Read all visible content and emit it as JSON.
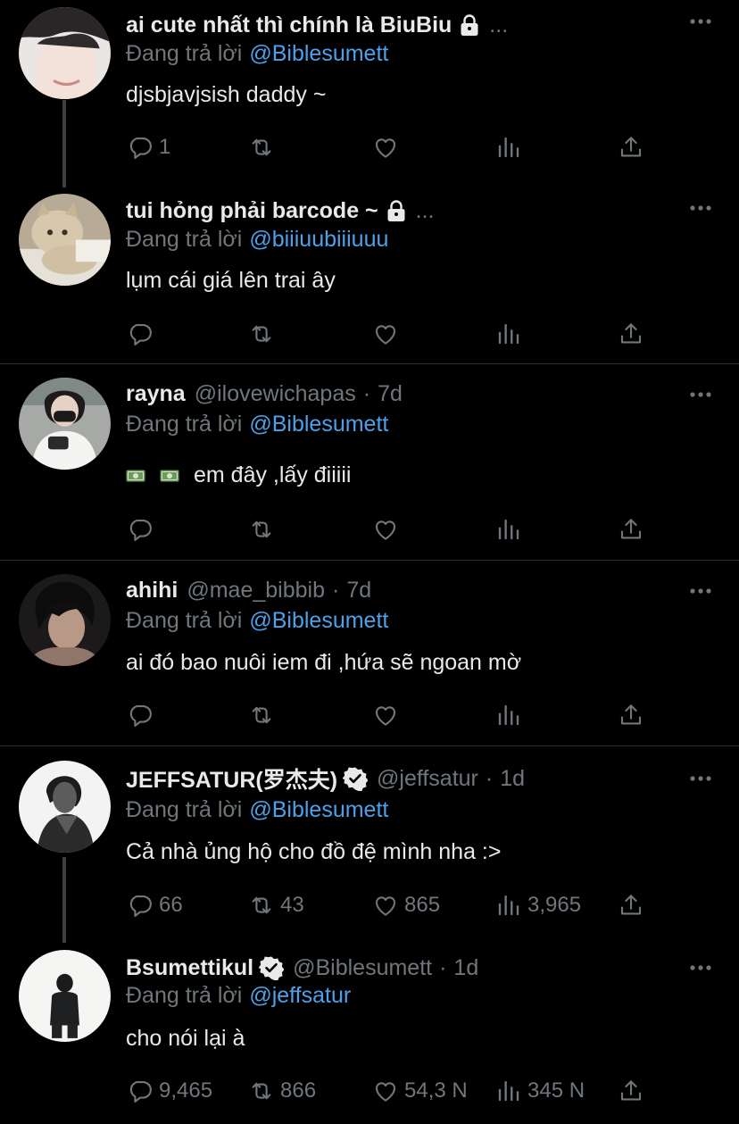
{
  "reply_prefix": "Đang trả lời",
  "tweets": [
    {
      "name": "ai cute nhất thì chính là BiuBiu",
      "handle": "",
      "time": "",
      "locked": true,
      "trailing": "...",
      "reply_to": "@Biblesumett",
      "text": "djsbjavjsish daddy ~",
      "replies": "1",
      "retweets": "",
      "likes": "",
      "views": ""
    },
    {
      "name": "tui hỏng phải barcode ~",
      "handle": "",
      "time": "",
      "locked": true,
      "trailing": "...",
      "reply_to": "@biiiuubiiiuuu",
      "text": "lụm cái giá lên trai ây",
      "replies": "",
      "retweets": "",
      "likes": "",
      "views": ""
    },
    {
      "name": "rayna",
      "handle": "@ilovewichapas",
      "time": "7d",
      "locked": false,
      "trailing": "",
      "reply_to": "@Biblesumett",
      "text": "em đây ,lấy điiiii",
      "replies": "",
      "retweets": "",
      "likes": "",
      "views": ""
    },
    {
      "name": "ahihi",
      "handle": "@mae_bibbib",
      "time": "7d",
      "locked": false,
      "trailing": "",
      "reply_to": "@Biblesumett",
      "text": "ai đó bao nuôi iem đi ,hứa sẽ ngoan mờ",
      "replies": "",
      "retweets": "",
      "likes": "",
      "views": ""
    },
    {
      "name": "JEFFSATUR(罗杰夫)",
      "handle": "@jeffsatur",
      "time": "1d",
      "locked": false,
      "verified": true,
      "trailing": "",
      "reply_to": "@Biblesumett",
      "text": "Cả nhà ủng hộ cho đồ đệ mình nha :>",
      "replies": "66",
      "retweets": "43",
      "likes": "865",
      "views": "3,965"
    },
    {
      "name": "Bsumettikul",
      "handle": "@Biblesumett",
      "time": "1d",
      "locked": false,
      "verified": true,
      "trailing": "",
      "reply_to": "@jeffsatur",
      "text": "cho nói lại à",
      "replies": "9,465",
      "retweets": "866",
      "likes": "54,3 N",
      "views": "345 N"
    }
  ],
  "colors": {
    "background": "#000000",
    "text": "#e7e9ea",
    "muted": "#71767b",
    "mention": "#4ca1ea",
    "divider": "#2f3336"
  },
  "icons": [
    "lock-icon",
    "verified-badge-icon",
    "more-options-icon",
    "reply-icon",
    "retweet-icon",
    "like-icon",
    "views-icon",
    "share-icon",
    "money-emoji-icon"
  ]
}
